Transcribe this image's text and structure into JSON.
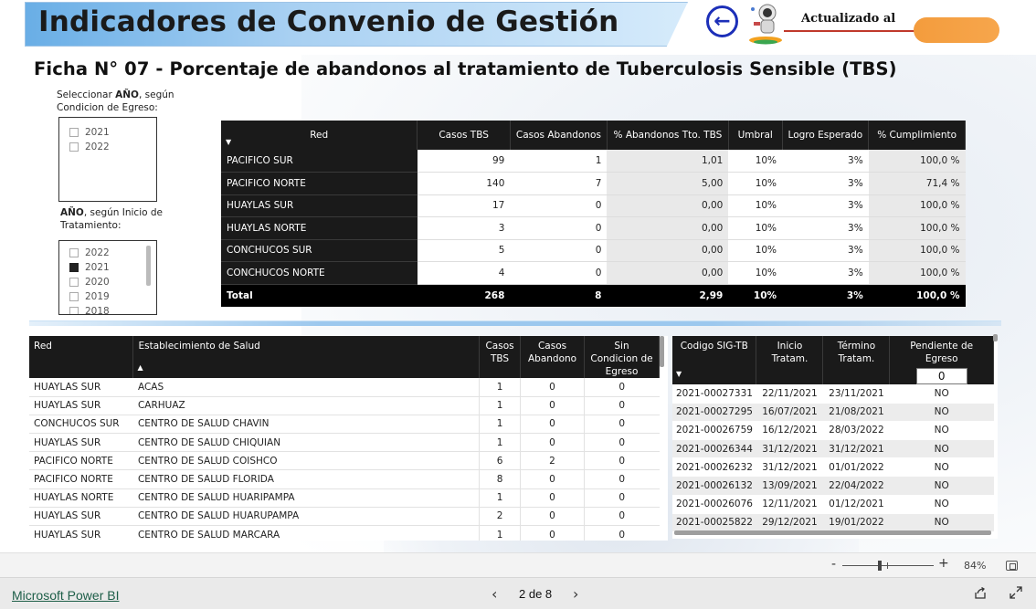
{
  "header": {
    "title": "Indicadores de Convenio de Gestión",
    "updated_label": "Actualizado al",
    "back_icon": "arrow-left-icon",
    "subtitle": "Ficha N° 07 - Porcentaje de abandonos al tratamiento de Tuberculosis Sensible (TBS)"
  },
  "slicer_egreso": {
    "title_pre": "Seleccionar ",
    "title_bold": "AÑO",
    "title_post": ", según Condicion de Egreso:",
    "items": [
      {
        "label": "2021",
        "checked": false
      },
      {
        "label": "2022",
        "checked": false
      }
    ]
  },
  "slicer_inicio": {
    "title_bold": "AÑO",
    "title_post": ", según Inicio de Tratamiento:",
    "items": [
      {
        "label": "2022",
        "checked": false
      },
      {
        "label": "2021",
        "checked": true
      },
      {
        "label": "2020",
        "checked": false
      },
      {
        "label": "2019",
        "checked": false
      },
      {
        "label": "2018",
        "checked": false
      }
    ]
  },
  "summary": {
    "headers": [
      "Red",
      "Casos TBS",
      "Casos Abandonos",
      "% Abandonos Tto. TBS",
      "Umbral",
      "Logro Esperado",
      "% Cumplimiento"
    ],
    "rows": [
      [
        "PACIFICO SUR",
        "99",
        "1",
        "1,01",
        "10%",
        "3%",
        "100,0 %"
      ],
      [
        "PACIFICO NORTE",
        "140",
        "7",
        "5,00",
        "10%",
        "3%",
        "71,4 %"
      ],
      [
        "HUAYLAS SUR",
        "17",
        "0",
        "0,00",
        "10%",
        "3%",
        "100,0 %"
      ],
      [
        "HUAYLAS NORTE",
        "3",
        "0",
        "0,00",
        "10%",
        "3%",
        "100,0 %"
      ],
      [
        "CONCHUCOS SUR",
        "5",
        "0",
        "0,00",
        "10%",
        "3%",
        "100,0 %"
      ],
      [
        "CONCHUCOS NORTE",
        "4",
        "0",
        "0,00",
        "10%",
        "3%",
        "100,0 %"
      ]
    ],
    "total": [
      "Total",
      "268",
      "8",
      "2,99",
      "10%",
      "3%",
      "100,0 %"
    ]
  },
  "establecimientos": {
    "headers": [
      "Red",
      "Establecimiento de Salud",
      "Casos TBS",
      "Casos Abandono",
      "Sin Condicion de Egreso"
    ],
    "rows": [
      [
        "HUAYLAS SUR",
        "ACAS",
        "1",
        "0",
        "0"
      ],
      [
        "HUAYLAS SUR",
        "CARHUAZ",
        "1",
        "0",
        "0"
      ],
      [
        "CONCHUCOS SUR",
        "CENTRO DE SALUD CHAVIN",
        "1",
        "0",
        "0"
      ],
      [
        "HUAYLAS SUR",
        "CENTRO DE SALUD CHIQUIAN",
        "1",
        "0",
        "0"
      ],
      [
        "PACIFICO NORTE",
        "CENTRO DE SALUD COISHCO",
        "6",
        "2",
        "0"
      ],
      [
        "PACIFICO NORTE",
        "CENTRO DE SALUD FLORIDA",
        "8",
        "0",
        "0"
      ],
      [
        "HUAYLAS NORTE",
        "CENTRO DE SALUD HUARIPAMPA",
        "1",
        "0",
        "0"
      ],
      [
        "HUAYLAS SUR",
        "CENTRO DE SALUD HUARUPAMPA",
        "2",
        "0",
        "0"
      ],
      [
        "HUAYLAS SUR",
        "CENTRO DE SALUD MARCARA",
        "1",
        "0",
        "0"
      ]
    ]
  },
  "sig": {
    "headers": [
      "Codigo SIG-TB",
      "Inicio Tratam.",
      "Término Tratam.",
      "Pendiente de Egreso"
    ],
    "pending_value": "0",
    "rows": [
      [
        "2021-00027331",
        "22/11/2021",
        "23/11/2021",
        "NO"
      ],
      [
        "2021-00027295",
        "16/07/2021",
        "21/08/2021",
        "NO"
      ],
      [
        "2021-00026759",
        "16/12/2021",
        "28/03/2022",
        "NO"
      ],
      [
        "2021-00026344",
        "31/12/2021",
        "31/12/2021",
        "NO"
      ],
      [
        "2021-00026232",
        "31/12/2021",
        "01/01/2022",
        "NO"
      ],
      [
        "2021-00026132",
        "13/09/2021",
        "22/04/2022",
        "NO"
      ],
      [
        "2021-00026076",
        "12/11/2021",
        "01/12/2021",
        "NO"
      ],
      [
        "2021-00025822",
        "29/12/2021",
        "19/01/2022",
        "NO"
      ]
    ]
  },
  "zoom": {
    "minus": "-",
    "plus": "+",
    "percent": "84%"
  },
  "footer": {
    "brand": "Microsoft Power BI",
    "page_indicator": "2 de 8",
    "prev": "‹",
    "next": "›"
  }
}
